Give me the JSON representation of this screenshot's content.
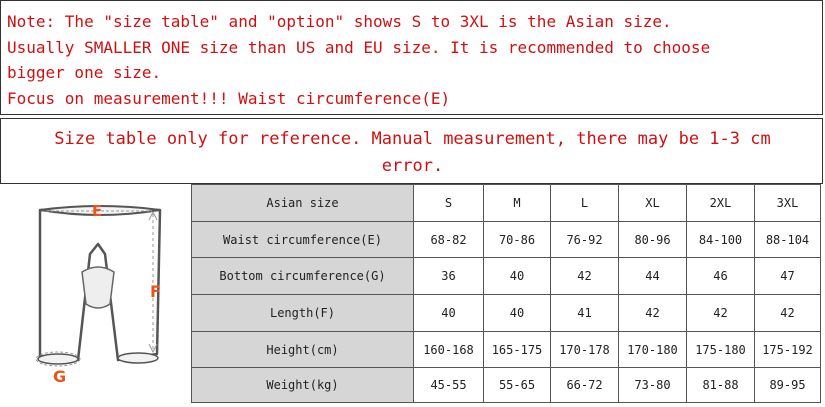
{
  "notes": {
    "line1": "Note: The \"size table\" and \"option\" shows S to 3XL is the Asian size.",
    "line2": "Usually SMALLER ONE size than US and EU size. It is recommended to choose",
    "line3": "bigger one size.",
    "line4": "Focus on measurement!!! Waist circumference(E)"
  },
  "reference": {
    "line1": "Size table only for reference. Manual measurement, there may be 1-3 cm",
    "line2": "error."
  },
  "illustration": {
    "label_e": "E",
    "label_f": "F",
    "label_g": "G"
  },
  "colors": {
    "text_red": "#d01010",
    "header_gray": "#d6d6d6",
    "illustration_orange": "#e8561b"
  },
  "table": {
    "corner": "Asian size",
    "sizes": [
      "S",
      "M",
      "L",
      "XL",
      "2XL",
      "3XL"
    ],
    "rows": [
      {
        "label": "Waist circumference(E)",
        "values": [
          "68-82",
          "70-86",
          "76-92",
          "80-96",
          "84-100",
          "88-104"
        ]
      },
      {
        "label": "Bottom circumference(G)",
        "values": [
          "36",
          "40",
          "42",
          "44",
          "46",
          "47"
        ]
      },
      {
        "label": "Length(F)",
        "values": [
          "40",
          "40",
          "41",
          "42",
          "42",
          "42"
        ]
      },
      {
        "label": "Height(cm)",
        "values": [
          "160-168",
          "165-175",
          "170-178",
          "170-180",
          "175-180",
          "175-192"
        ]
      },
      {
        "label": "Weight(kg)",
        "values": [
          "45-55",
          "55-65",
          "66-72",
          "73-80",
          "81-88",
          "89-95"
        ]
      }
    ]
  }
}
